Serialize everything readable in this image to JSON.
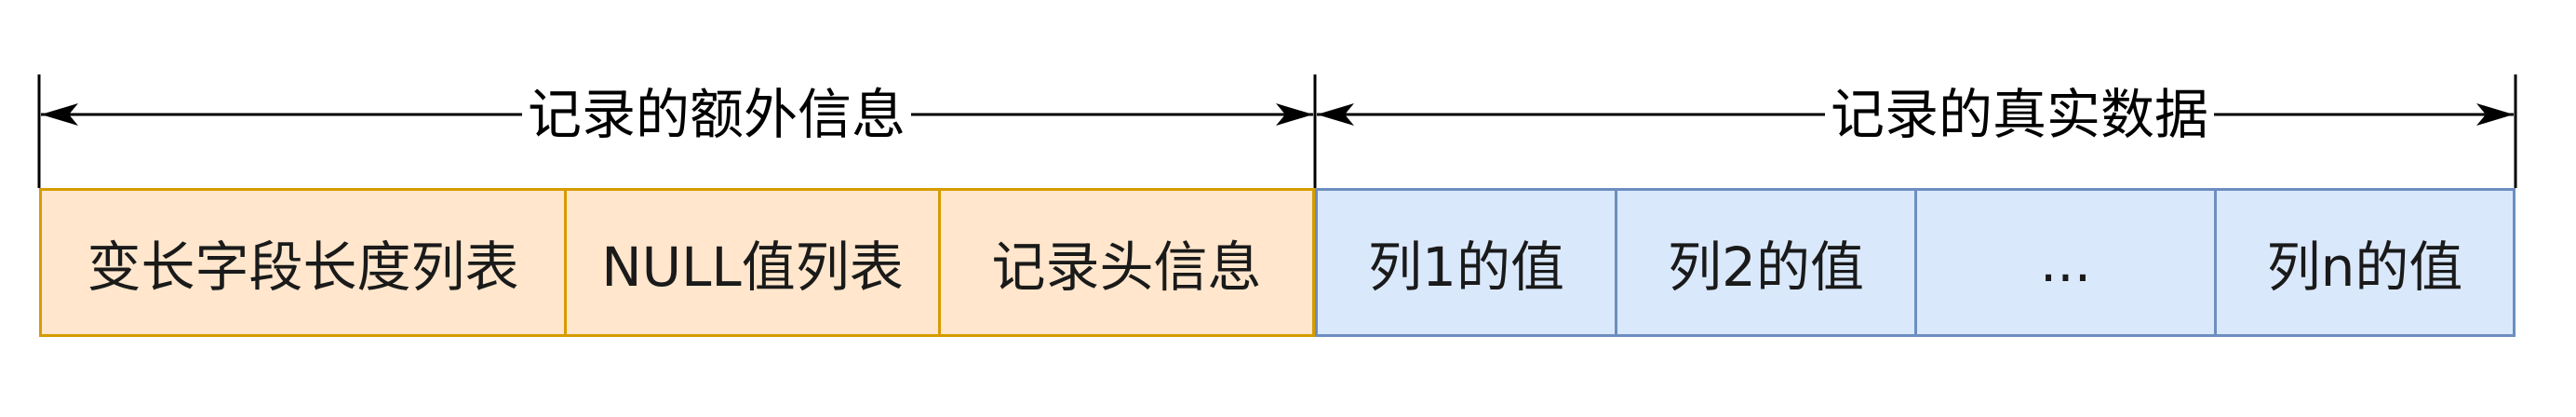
{
  "sections": [
    {
      "label": "记录的额外信息",
      "fill_color": "#ffe6cc",
      "border_color": "#d79b00",
      "cells": [
        {
          "label": "变长字段长度列表"
        },
        {
          "label": "NULL值列表"
        },
        {
          "label": "记录头信息"
        }
      ]
    },
    {
      "label": "记录的真实数据",
      "fill_color": "#dae8fc",
      "border_color": "#6c8ebf",
      "cells": [
        {
          "label": "列1的值"
        },
        {
          "label": "列2的值"
        },
        {
          "label": "..."
        },
        {
          "label": "列n的值"
        }
      ]
    }
  ]
}
